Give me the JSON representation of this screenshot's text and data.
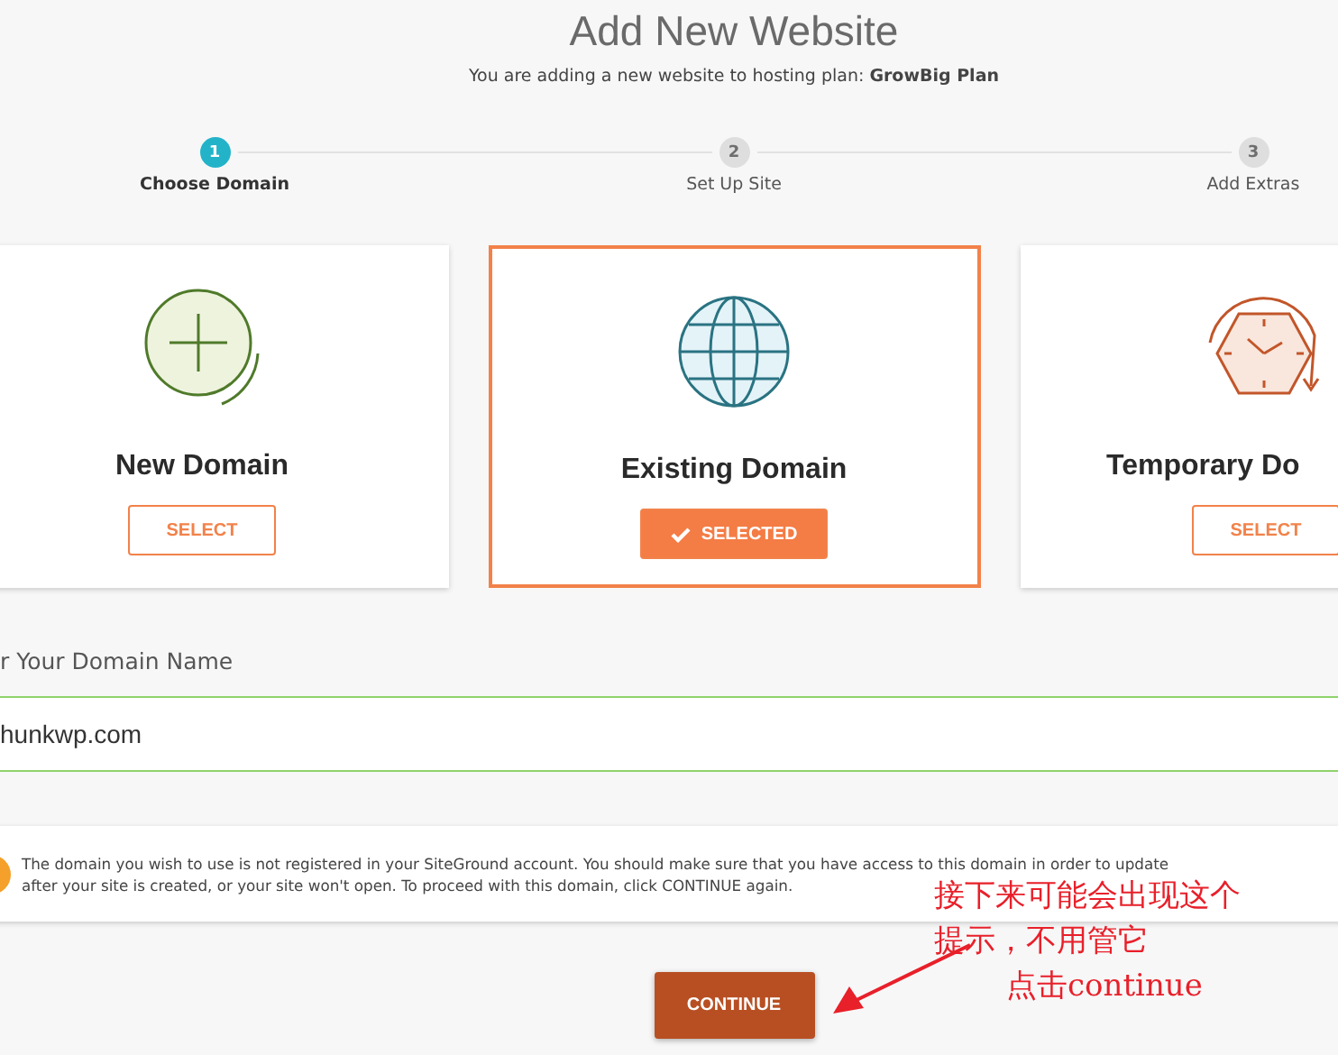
{
  "header": {
    "title": "Add New Website",
    "subtitle": "You are adding a new website to hosting plan: **GrowBig Plan**"
  },
  "steps": [
    {
      "number": "1",
      "label": "Choose Domain",
      "selected": true
    },
    {
      "number": "2",
      "label": "Set Up Site",
      "selected": false
    },
    {
      "number": "3",
      "label": "Add Extras",
      "selected": false
    }
  ],
  "cards": [
    {
      "kind": "new",
      "title": "New Domain",
      "button": "SELECT",
      "selected": false
    },
    {
      "kind": "existing",
      "title": "Existing Domain",
      "button": "SELECTED",
      "selected": true
    },
    {
      "kind": "temporary",
      "title": "Temporary Do",
      "button": "SELECT",
      "selected": false
    }
  ],
  "domain_field": {
    "label": "r Your Domain Name",
    "value": "hunkwp.com"
  },
  "notice": {
    "lines": [
      "The domain you wish to use is not registered in your SiteGround account. You should make sure that you have access to this domain in order to update",
      "after your site is created, or your site won't open. To proceed with this domain, click CONTINUE again."
    ]
  },
  "continue_button": "CONTINUE",
  "annotation": {
    "lines": [
      "接下来可能会出现这个",
      "提示，不用管它",
      "点击continue"
    ]
  }
}
